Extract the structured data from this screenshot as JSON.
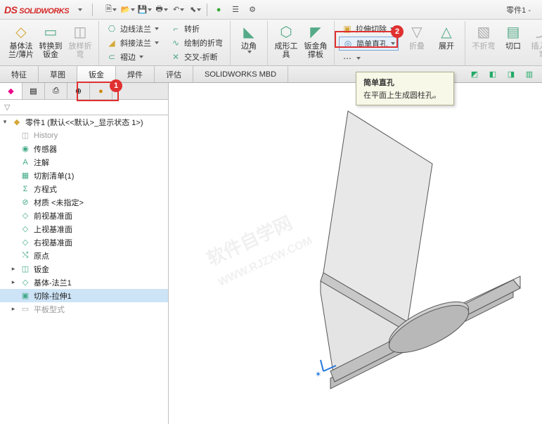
{
  "app": {
    "name": "SOLIDWORKS",
    "docTitle": "零件1 -"
  },
  "ribbon": {
    "g1": [
      {
        "label": "基体法兰/薄片",
        "ico": "◇"
      },
      {
        "label": "转换到钣金",
        "ico": "▭"
      },
      {
        "label": "放样折弯",
        "ico": "◫",
        "dis": true
      }
    ],
    "g2a": [
      {
        "label": "边线法兰",
        "ico": "⎔"
      },
      {
        "label": "斜接法兰",
        "ico": "◢"
      },
      {
        "label": "褶边",
        "ico": "⊂"
      }
    ],
    "g2b": [
      {
        "label": "转折",
        "ico": "⌐"
      },
      {
        "label": "绘制的折弯",
        "ico": "∿"
      },
      {
        "label": "交叉-折断",
        "ico": "✕"
      }
    ],
    "g3": [
      {
        "label": "边角",
        "ico": "◣"
      }
    ],
    "g4": [
      {
        "label": "成形工具",
        "ico": "⬡"
      },
      {
        "label": "钣金角撑板",
        "ico": "◤"
      }
    ],
    "g5a": [
      {
        "label": "拉伸切除",
        "ico": "▣"
      },
      {
        "label": "简单直孔",
        "ico": "◎"
      },
      {
        "label": " ",
        "ico": "⋯"
      }
    ],
    "g5b": [
      {
        "label": "折叠",
        "ico": "▽",
        "dis": true
      },
      {
        "label": "展开",
        "ico": "△"
      }
    ],
    "g6": [
      {
        "label": "不折弯",
        "ico": "▧",
        "dis": true
      },
      {
        "label": "切口",
        "ico": "▤"
      },
      {
        "label": "插入折弯",
        "ico": "⤴",
        "dis": true
      }
    ]
  },
  "tabs": [
    "特征",
    "草图",
    "钣金",
    "焊件",
    "评估",
    "SOLIDWORKS MBD"
  ],
  "tree": {
    "root": "零件1 (默认<<默认>_显示状态 1>)",
    "items": [
      {
        "ico": "◫",
        "label": "History",
        "dim": true
      },
      {
        "ico": "◉",
        "label": "传感器"
      },
      {
        "ico": "A",
        "label": "注解"
      },
      {
        "ico": "▦",
        "label": "切割清单(1)"
      },
      {
        "ico": "Σ",
        "label": "方程式"
      },
      {
        "ico": "⊘",
        "label": "材质 <未指定>"
      },
      {
        "ico": "◇",
        "label": "前视基准面"
      },
      {
        "ico": "◇",
        "label": "上视基准面"
      },
      {
        "ico": "◇",
        "label": "右视基准面"
      },
      {
        "ico": "⤭",
        "label": "原点"
      },
      {
        "ico": "◫",
        "label": "钣金",
        "exp": true
      },
      {
        "ico": "◇",
        "label": "基体-法兰1",
        "exp": true
      },
      {
        "ico": "▣",
        "label": "切除-拉伸1",
        "sel": true
      },
      {
        "ico": "▭",
        "label": "平板型式",
        "dim": true,
        "exp": true
      }
    ]
  },
  "tooltip": {
    "title": "简单直孔",
    "body": "在平面上生成圆柱孔。"
  },
  "annot": {
    "b1": "1",
    "b2": "2"
  }
}
